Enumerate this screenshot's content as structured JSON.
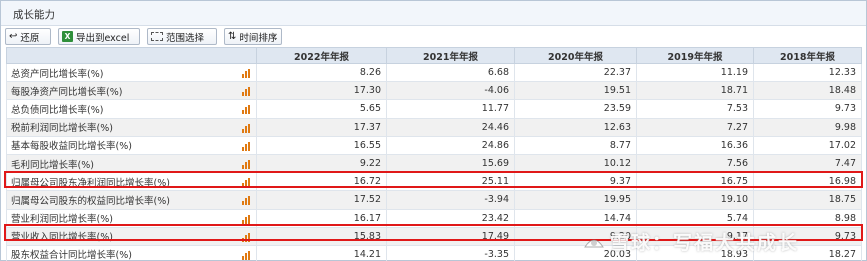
{
  "panel": {
    "title": "成长能力"
  },
  "toolbar": {
    "restore_label": "还原",
    "export_label": "导出到excel",
    "range_label": "范围选择",
    "sort_label": "时间排序"
  },
  "table": {
    "columns": [
      "",
      "2022年年报",
      "2021年年报",
      "2020年年报",
      "2019年年报",
      "2018年年报"
    ],
    "rows": [
      {
        "name": "总资产同比增长率(%)",
        "values": [
          "8.26",
          "6.68",
          "22.37",
          "11.19",
          "12.33"
        ]
      },
      {
        "name": "每股净资产同比增长率(%)",
        "values": [
          "17.30",
          "-4.06",
          "19.51",
          "18.71",
          "18.48"
        ]
      },
      {
        "name": "总负债同比增长率(%)",
        "values": [
          "5.65",
          "11.77",
          "23.59",
          "7.53",
          "9.73"
        ]
      },
      {
        "name": "税前利润同比增长率(%)",
        "values": [
          "17.37",
          "24.46",
          "12.63",
          "7.27",
          "9.98"
        ]
      },
      {
        "name": "基本每股收益同比增长率(%)",
        "values": [
          "16.55",
          "24.86",
          "8.77",
          "16.36",
          "17.02"
        ]
      },
      {
        "name": "毛利同比增长率(%)",
        "values": [
          "9.22",
          "15.69",
          "10.12",
          "7.56",
          "7.47"
        ]
      },
      {
        "name": "归属母公司股东净利润同比增长率(%)",
        "values": [
          "16.72",
          "25.11",
          "9.37",
          "16.75",
          "16.98"
        ]
      },
      {
        "name": "归属母公司股东的权益同比增长率(%)",
        "values": [
          "17.52",
          "-3.94",
          "19.95",
          "19.10",
          "18.75"
        ]
      },
      {
        "name": "营业利润同比增长率(%)",
        "values": [
          "16.17",
          "23.42",
          "14.74",
          "5.74",
          "8.98"
        ]
      },
      {
        "name": "营业收入同比增长率(%)",
        "values": [
          "15.83",
          "17.49",
          "9.20",
          "9.17",
          "9.73"
        ]
      },
      {
        "name": "股东权益合计同比增长率(%)",
        "values": [
          "14.21",
          "-3.35",
          "20.03",
          "18.93",
          "18.27"
        ]
      }
    ],
    "highlighted_rows": [
      6,
      9
    ],
    "highlight_color": "#e01818",
    "row_icon": "bar-chart-icon"
  },
  "watermark": {
    "text": "雪球：写福大共成长"
  }
}
